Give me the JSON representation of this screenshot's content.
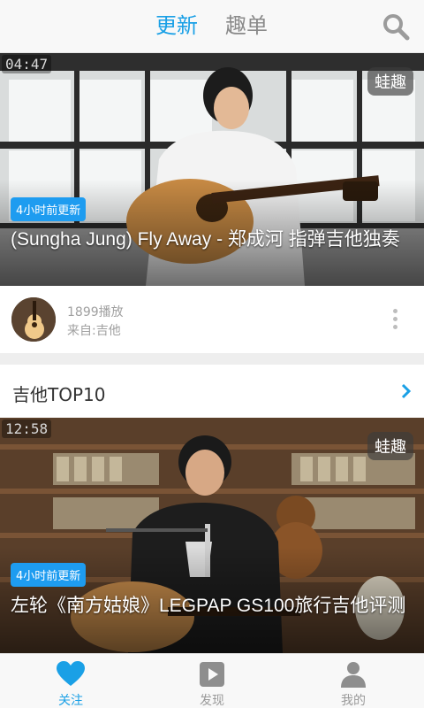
{
  "header": {
    "tabs": [
      {
        "label": "更新",
        "active": true
      },
      {
        "label": "趣单",
        "active": false
      }
    ],
    "search_icon": "search-icon"
  },
  "feed": [
    {
      "duration": "04:47",
      "watermark": "蛙趣",
      "badge": "4小时前更新",
      "title": "(Sungha Jung) Fly Away - 郑成河 指弹吉他独奏"
    },
    {
      "duration": "12:58",
      "watermark": "蛙趣",
      "badge": "4小时前更新",
      "title": "左轮《南方姑娘》LEGPAP GS100旅行吉他评测"
    }
  ],
  "info_row": {
    "plays": "1899播放",
    "source": "来自:吉他"
  },
  "section": {
    "title": "吉他TOP10"
  },
  "bottom_nav": [
    {
      "label": "关注",
      "icon": "heart-icon",
      "active": true
    },
    {
      "label": "发现",
      "icon": "play-icon",
      "active": false
    },
    {
      "label": "我的",
      "icon": "user-icon",
      "active": false
    }
  ],
  "colors": {
    "accent": "#1aa0e6",
    "badge": "#1e9cf0",
    "muted": "#9a9a9a"
  }
}
